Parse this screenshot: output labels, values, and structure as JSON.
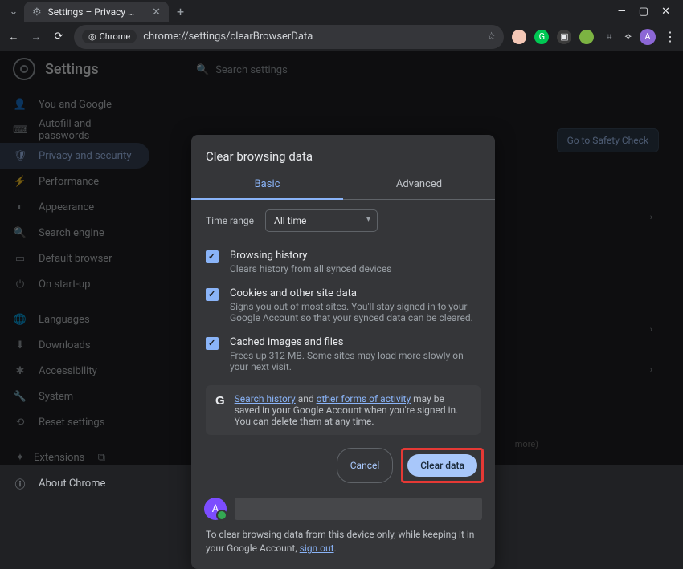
{
  "window": {
    "tab_title": "Settings – Privacy and security",
    "url": "chrome://settings/clearBrowserData",
    "chrome_chip": "Chrome"
  },
  "settings_title": "Settings",
  "search_placeholder": "Search settings",
  "safety_check": "Go to Safety Check",
  "sidebar": {
    "items": [
      {
        "label": "You and Google"
      },
      {
        "label": "Autofill and passwords"
      },
      {
        "label": "Privacy and security"
      },
      {
        "label": "Performance"
      },
      {
        "label": "Appearance"
      },
      {
        "label": "Search engine"
      },
      {
        "label": "Default browser"
      },
      {
        "label": "On start-up"
      }
    ],
    "items2": [
      {
        "label": "Languages"
      },
      {
        "label": "Downloads"
      },
      {
        "label": "Accessibility"
      },
      {
        "label": "System"
      },
      {
        "label": "Reset settings"
      }
    ],
    "items3": [
      {
        "label": "Extensions"
      },
      {
        "label": "About Chrome"
      }
    ]
  },
  "dialog": {
    "title": "Clear browsing data",
    "tabs": {
      "basic": "Basic",
      "advanced": "Advanced"
    },
    "time_label": "Time range",
    "time_value": "All time",
    "checks": [
      {
        "title": "Browsing history",
        "sub": "Clears history from all synced devices"
      },
      {
        "title": "Cookies and other site data",
        "sub": "Signs you out of most sites. You'll stay signed in to your Google Account so that your synced data can be cleared."
      },
      {
        "title": "Cached images and files",
        "sub": "Frees up 312 MB. Some sites may load more slowly on your next visit."
      }
    ],
    "info_pre": "",
    "info_link1": "Search history",
    "info_mid": " and ",
    "info_link2": "other forms of activity",
    "info_post": " may be saved in your Google Account when you're signed in. You can delete them at any time.",
    "cancel": "Cancel",
    "clear": "Clear data",
    "account_initial": "A",
    "footer_pre": "To clear browsing data from this device only, while keeping it in your Google Account, ",
    "footer_link": "sign out",
    "footer_post": "."
  },
  "more_text": "more)"
}
